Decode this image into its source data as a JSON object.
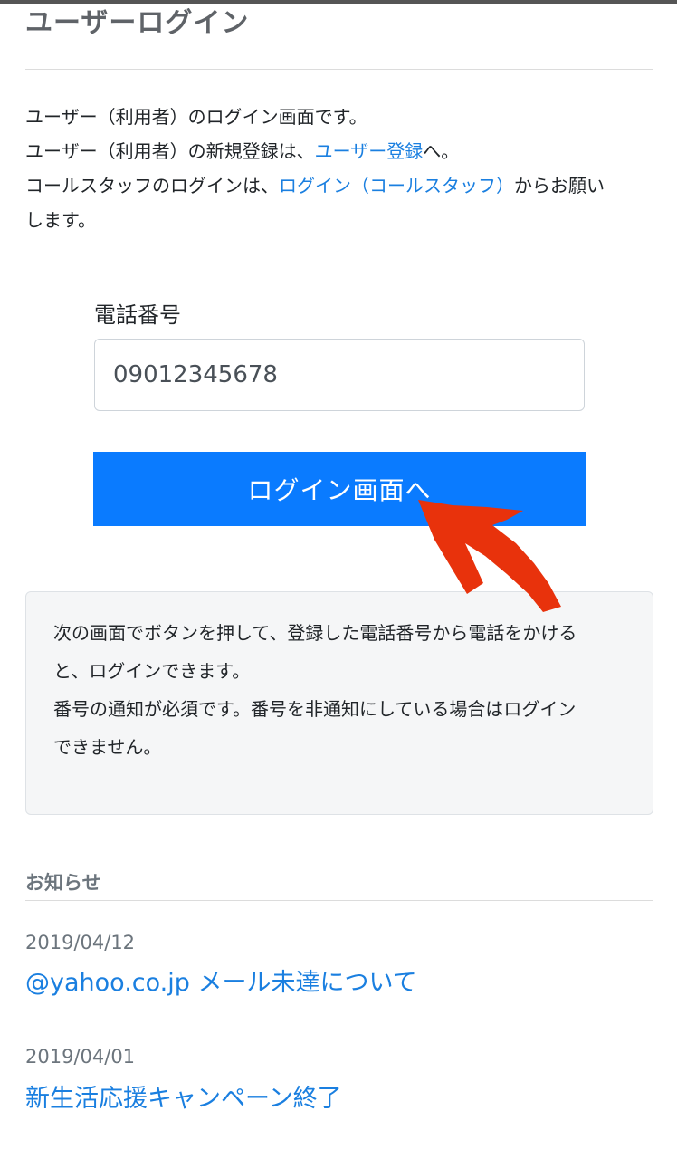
{
  "header": {
    "title": "ユーザーログイン"
  },
  "intro": {
    "line1": "ユーザー（利用者）のログイン画面です。",
    "line2_prefix": "ユーザー（利用者）の新規登録は、",
    "line2_link": "ユーザー登録",
    "line2_suffix": "へ。",
    "line3_prefix": "コールスタッフのログインは、",
    "line3_link": "ログイン（コールスタッフ）",
    "line3_suffix": "からお願い",
    "line4": "します。"
  },
  "form": {
    "phone_label": "電話番号",
    "phone_value": "09012345678",
    "submit_label": "ログイン画面へ"
  },
  "notice": {
    "line1": "次の画面でボタンを押して、登録した電話番号から電話をかける",
    "line2": "と、ログインできます。",
    "line3": "番号の通知が必須です。番号を非通知にしている場合はログイン",
    "line4": "できません。"
  },
  "news": {
    "heading": "お知らせ",
    "items": [
      {
        "date": "2019/04/12",
        "title": "@yahoo.co.jp メール未達について"
      },
      {
        "date": "2019/04/01",
        "title": "新生活応援キャンペーン終了"
      }
    ]
  },
  "colors": {
    "primary_button": "#0a7bff",
    "link": "#1a7fe0",
    "annotation_arrow": "#e8320c"
  },
  "icons": {
    "annotation": "red-arrow-icon"
  }
}
